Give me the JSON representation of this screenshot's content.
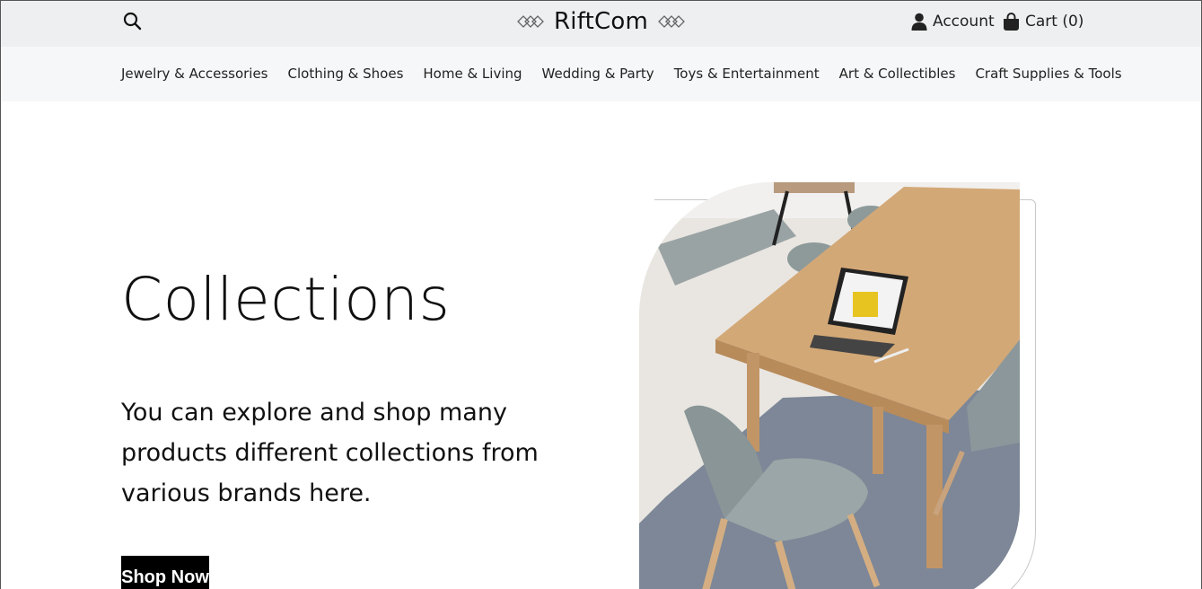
{
  "header": {
    "brand": "RiftCom",
    "account_label": "Account",
    "cart_label": "Cart (0)"
  },
  "icons": {
    "search": "search-icon",
    "brand_left": "diamond-chain-icon",
    "brand_right": "diamond-chain-icon",
    "account": "user-icon",
    "cart": "shopping-bag-icon"
  },
  "categories": [
    "Jewelry & Accessories",
    "Clothing & Shoes",
    "Home & Living",
    "Wedding & Party",
    "Toys & Entertainment",
    "Art & Collectibles",
    "Craft Supplies & Tools"
  ],
  "hero": {
    "title": "Collections",
    "subtitle": "You can explore and shop many products different collections from various brands here.",
    "cta_label": "Shop Now"
  },
  "colors": {
    "topbar_bg": "#eeeff0",
    "nav_bg": "#f6f7f8",
    "cta_bg": "#000000",
    "cta_text": "#ffffff"
  }
}
